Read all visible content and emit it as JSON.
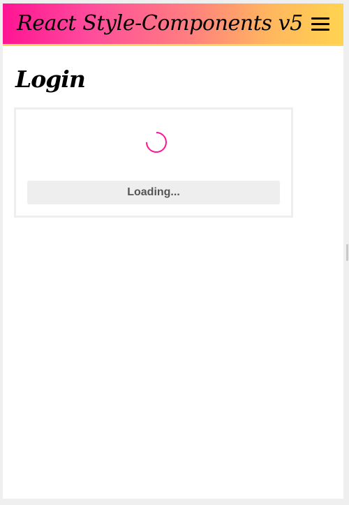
{
  "header": {
    "brand": "React Style-Components v5",
    "menu_icon": "hamburger-menu-icon",
    "gradient_start": "#ff1493",
    "gradient_end": "#ffd34f"
  },
  "login": {
    "title": "Login",
    "spinner_icon": "loading-spinner-icon",
    "button_label": "Loading..."
  },
  "colors": {
    "accent": "#ff1493",
    "card_border": "#eeeeee",
    "button_background": "#eeeeee",
    "button_text": "#555555"
  }
}
